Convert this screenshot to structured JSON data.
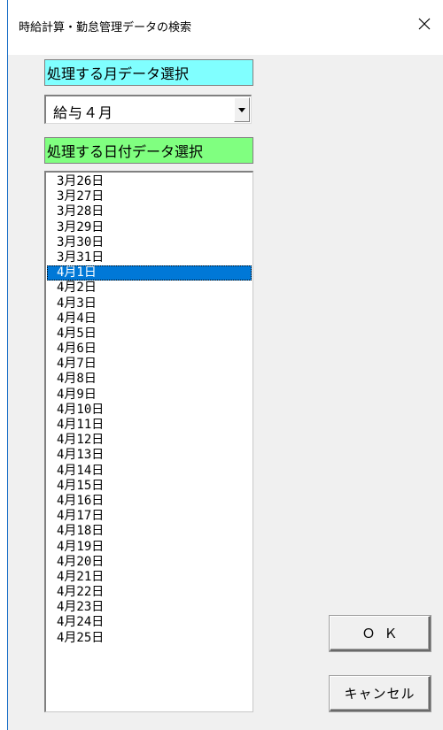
{
  "window": {
    "title": "時給計算・勤怠管理データの検索",
    "close_icon": "close-icon"
  },
  "month_section": {
    "label": "処理する月データ選択",
    "label_color": "#80ffff",
    "selected_value": "給与４月"
  },
  "date_section": {
    "label": "処理する日付データ選択",
    "label_color": "#80ff80",
    "selected_index": 6,
    "items": [
      "3月26日",
      "3月27日",
      "3月28日",
      "3月29日",
      "3月30日",
      "3月31日",
      "4月1日",
      "4月2日",
      "4月3日",
      "4月4日",
      "4月5日",
      "4月6日",
      "4月7日",
      "4月8日",
      "4月9日",
      "4月10日",
      "4月11日",
      "4月12日",
      "4月13日",
      "4月14日",
      "4月15日",
      "4月16日",
      "4月17日",
      "4月18日",
      "4月19日",
      "4月20日",
      "4月21日",
      "4月22日",
      "4月23日",
      "4月24日",
      "4月25日"
    ]
  },
  "buttons": {
    "ok_label": "ＯＫ",
    "cancel_label": "キャンセル"
  },
  "colors": {
    "selection": "#0078d7"
  }
}
